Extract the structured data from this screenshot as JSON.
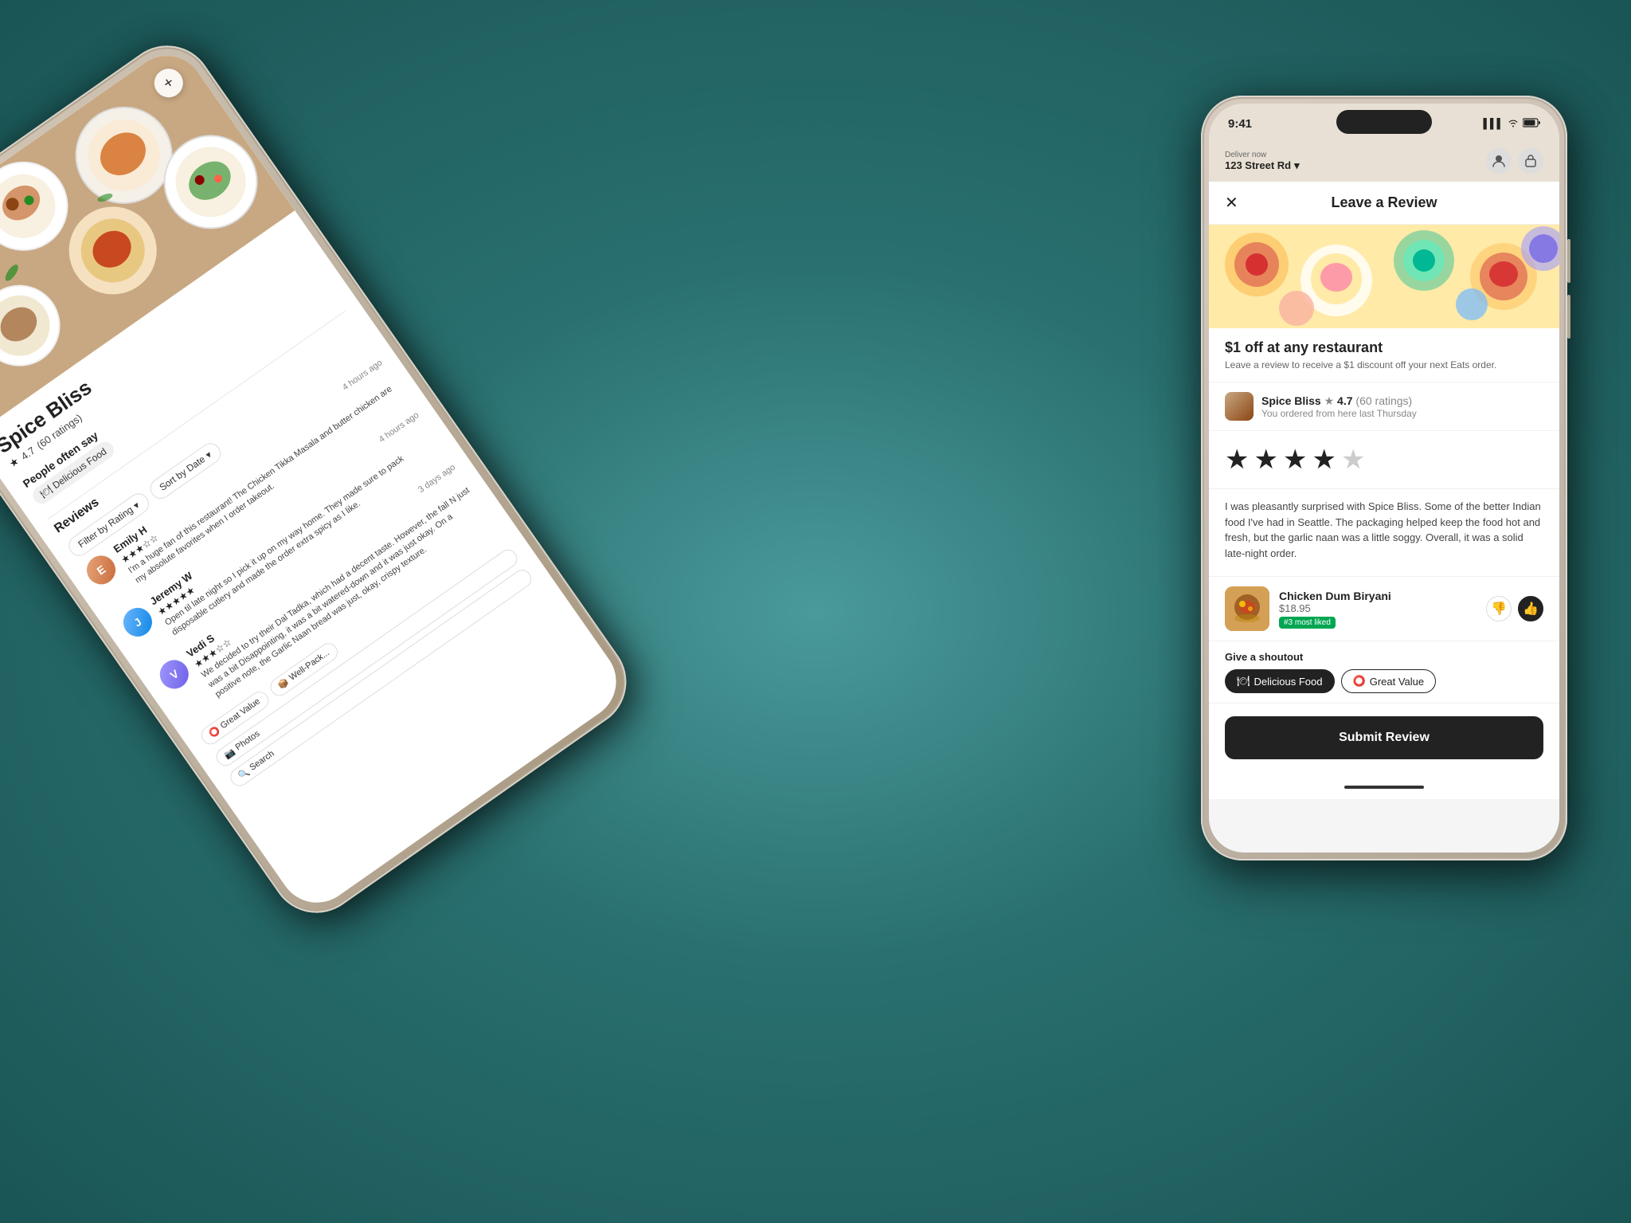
{
  "scene": {
    "background_color": "#3a8888"
  },
  "left_phone": {
    "restaurant_name": "Spice Bliss",
    "rating": "4.7",
    "rating_count": "(60 ratings)",
    "people_say_label": "People often say",
    "delicious_food_tag": "Delicious Food",
    "reviews_label": "Reviews",
    "filter_by_rating": "Filter by Rating",
    "sort_by_date": "Sort by Date",
    "shoutout_great_value": "Great Value",
    "shoutout_well_packed": "Well-Pack...",
    "photos_label": "Photos",
    "search_label": "Search",
    "add_btn": "+",
    "reviews": [
      {
        "name": "Emily H",
        "time": "4 hours ago",
        "stars": "★★★☆☆",
        "text": "I'm a huge fan of this restaurant! The Chicken Tikka Masala and butter chicken are my absolute favorites when I order takeout."
      },
      {
        "name": "Jeremy W",
        "time": "4 hours ago",
        "stars": "★★★★★",
        "text": "Open til late night so I pick it up on my way home. They made sure to pack disposable cutlery and made the order extra spicy as I like."
      },
      {
        "name": "Vedi S",
        "time": "3 days ago",
        "stars": "★★★☆☆",
        "text": "We decided to try their Dal Tadka, which had a decent taste. However, the fall N just was a bit Disappointing, it was a bit watered-down and it was just okay. On a positive note, the Garlic Naan bread was just, okay, crispy texture."
      }
    ]
  },
  "right_phone": {
    "status_bar": {
      "time": "9:41",
      "signal": "▌▌▌",
      "wifi": "wifi",
      "battery": "battery"
    },
    "deliver_now_label": "Deliver now",
    "address": "123 Street Rd",
    "page_title": "Leave a Review",
    "close_icon": "✕",
    "promo": {
      "discount_title": "$1 off at any restaurant",
      "discount_subtitle": "Leave a review to receive a $1 discount off your next Eats order."
    },
    "restaurant": {
      "name": "Spice Bliss",
      "rating": "4.7",
      "rating_count": "(60 ratings)",
      "last_order": "You ordered from here last Thursday"
    },
    "star_rating": {
      "filled": 4,
      "empty": 1
    },
    "review_text": "I was pleasantly surprised with Spice Bliss. Some of the better Indian food I've had in Seattle. The packaging helped keep the food hot and fresh, but the garlic naan was a little soggy. Overall, it was a solid late-night order.",
    "food_item": {
      "name": "Chicken Dum Biryani",
      "price": "$18.95",
      "badge": "#3 most liked",
      "thumb_up": "👍",
      "thumb_down": "👎"
    },
    "give_shoutout_label": "Give a shoutout",
    "shoutout_tags": [
      {
        "icon": "🍽",
        "label": "Delicious Food",
        "selected": true
      },
      {
        "icon": "⭕",
        "label": "Great Value",
        "selected": false
      }
    ],
    "submit_label": "Submit Review"
  }
}
